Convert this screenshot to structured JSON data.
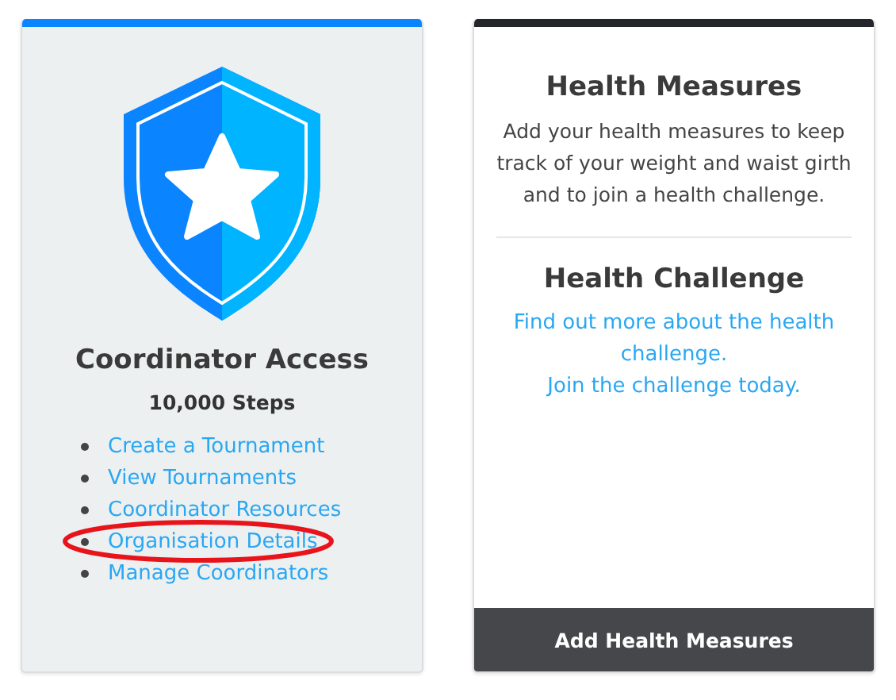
{
  "cards": [
    {
      "kind": "badge",
      "color": "#0a84ff",
      "title": "Coordinator Access",
      "subtitle": "10,000 Steps",
      "links": [
        {
          "label": "Create a Tournament",
          "circled": false
        },
        {
          "label": "View Tournaments",
          "circled": false
        },
        {
          "label": "Coordinator Resources",
          "circled": false
        },
        {
          "label": "Organisation Details",
          "circled": true
        },
        {
          "label": "Manage Coordinators",
          "circled": false
        }
      ]
    },
    {
      "kind": "info",
      "color": "#24262b",
      "sections": [
        {
          "title": "Health Measures",
          "text": "Add your health measures to keep track of your weight and waist girth and to join a health challenge."
        },
        {
          "title": "Health Challenge",
          "links": [
            "Find out more about the health challenge.",
            "Join the challenge today."
          ]
        }
      ],
      "button": "Add Health Measures"
    }
  ]
}
